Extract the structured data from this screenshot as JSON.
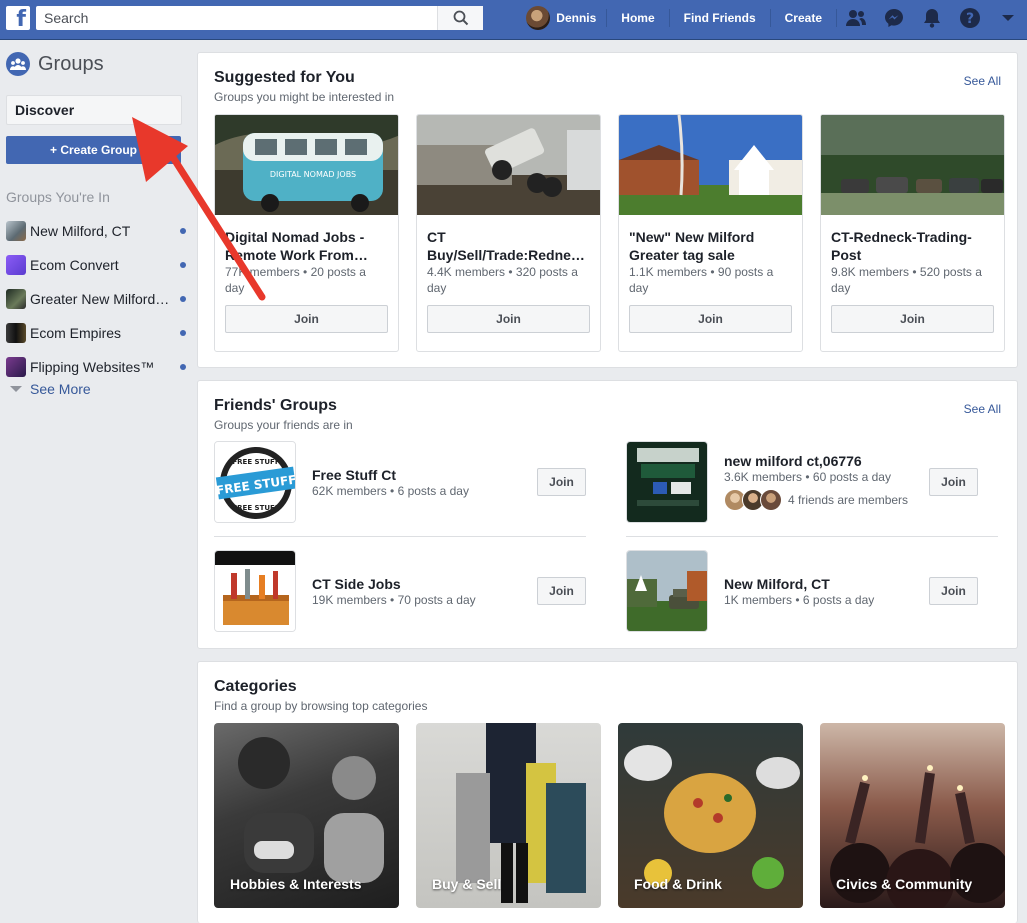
{
  "topbar": {
    "logo": "f",
    "search_placeholder": "Search",
    "user_name": "Dennis",
    "links": [
      "Home",
      "Find Friends",
      "Create"
    ],
    "icons": [
      "friend-requests-icon",
      "messenger-icon",
      "notifications-icon",
      "help-icon",
      "account-menu-icon"
    ]
  },
  "sidebar": {
    "title": "Groups",
    "discover": "Discover",
    "create_label": "+ Create Group",
    "section": "Groups You're In",
    "items": [
      {
        "label": "New Milford, CT",
        "thumb": "#7a8a95"
      },
      {
        "label": "Ecom Convert",
        "thumb": "#6b4fc4"
      },
      {
        "label": "Greater New Milford…",
        "thumb": "#3c4a3a"
      },
      {
        "label": "Ecom Empires",
        "thumb": "#2b2b2b"
      },
      {
        "label": "Flipping Websites™",
        "thumb": "#5b2a6e"
      }
    ],
    "see_more": "See More"
  },
  "suggested": {
    "title": "Suggested for You",
    "subtitle": "Groups you might be interested in",
    "see_all": "See All",
    "join": "Join",
    "cards": [
      {
        "name": "Digital Nomad Jobs - Remote Work From…",
        "meta": "77K members • 20 posts a day"
      },
      {
        "name": "CT Buy/Sell/Trade:Redne…",
        "meta": "4.4K members • 320 posts a day"
      },
      {
        "name": "\"New\" New Milford Greater tag sale",
        "meta": "1.1K members • 90 posts a day"
      },
      {
        "name": "CT-Redneck-Trading-Post",
        "meta": "9.8K members • 520 posts a day"
      }
    ]
  },
  "friends_groups": {
    "title": "Friends' Groups",
    "subtitle": "Groups your friends are in",
    "see_all": "See All",
    "join": "Join",
    "items": [
      {
        "name": "Free Stuff Ct",
        "meta": "62K members • 6 posts a day"
      },
      {
        "name": "new milford ct,06776",
        "meta": "3.6K members • 60 posts a day",
        "friends": "4 friends are members"
      },
      {
        "name": "CT Side Jobs",
        "meta": "19K members • 70 posts a day"
      },
      {
        "name": "New Milford, CT",
        "meta": "1K members • 6 posts a day"
      }
    ],
    "free_stuff_badge_top": "FREE STUFF",
    "free_stuff_badge_mid": "FREE STUFF",
    "free_stuff_badge_bot": "FREE STUFF"
  },
  "categories": {
    "title": "Categories",
    "subtitle": "Find a group by browsing top categories",
    "items": [
      "Hobbies & Interests",
      "Buy & Sell",
      "Food & Drink",
      "Civics & Community"
    ]
  },
  "overlay": {
    "arrow_color": "#e8382b"
  },
  "colors": {
    "brand": "#4267b2",
    "link": "#365899",
    "background": "#e9ebee"
  }
}
